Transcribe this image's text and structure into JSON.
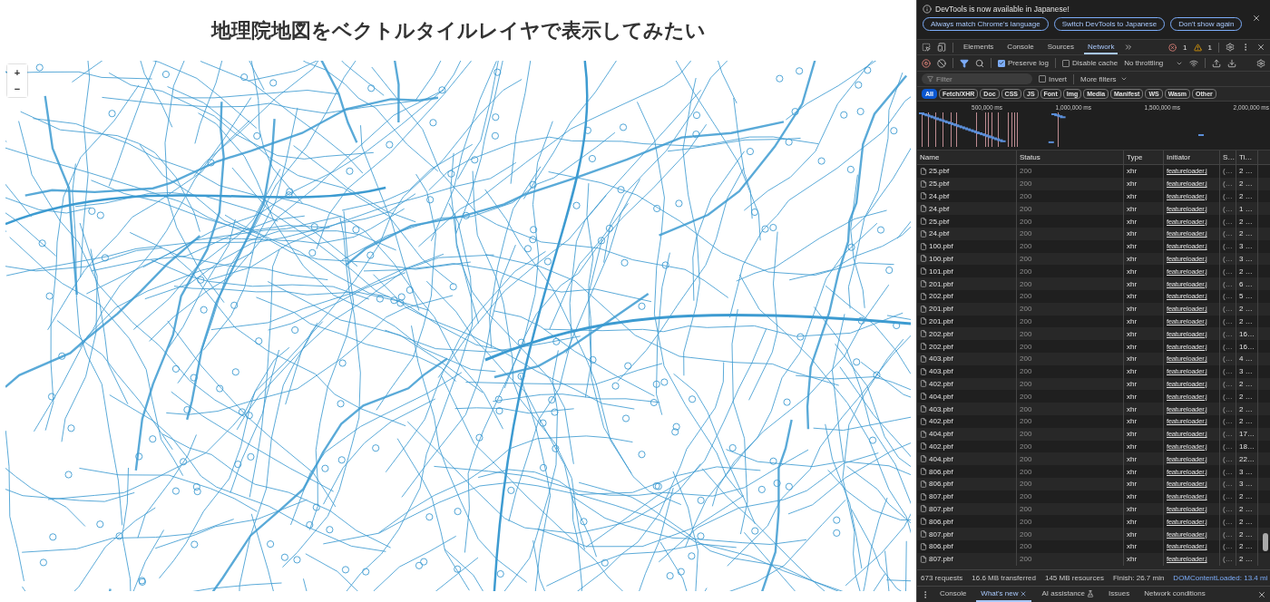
{
  "page": {
    "title": "地理院地図をベクトルタイルレイヤで表示してみたい",
    "zoom_controls": [
      "+",
      "−"
    ]
  },
  "devtools": {
    "infobar": {
      "message": "DevTools is now available in Japanese!",
      "buttons": [
        "Always match Chrome's language",
        "Switch DevTools to Japanese",
        "Don't show again"
      ]
    },
    "panel_tabs": [
      {
        "label": "Elements",
        "selected": false
      },
      {
        "label": "Console",
        "selected": false
      },
      {
        "label": "Sources",
        "selected": false
      },
      {
        "label": "Network",
        "selected": true
      }
    ],
    "error_count": "1",
    "warning_count": "1",
    "toolbar": {
      "preserve_log": {
        "label": "Preserve log",
        "checked": true
      },
      "disable_cache": {
        "label": "Disable cache",
        "checked": false
      },
      "throttling": "No throttling"
    },
    "filter": {
      "placeholder": "Filter",
      "invert": {
        "label": "Invert",
        "checked": false
      },
      "more_filters": "More filters"
    },
    "type_filters": [
      {
        "label": "All",
        "selected": true
      },
      {
        "label": "Fetch/XHR",
        "selected": false
      },
      {
        "label": "Doc",
        "selected": false
      },
      {
        "label": "CSS",
        "selected": false
      },
      {
        "label": "JS",
        "selected": false
      },
      {
        "label": "Font",
        "selected": false
      },
      {
        "label": "Img",
        "selected": false
      },
      {
        "label": "Media",
        "selected": false
      },
      {
        "label": "Manifest",
        "selected": false
      },
      {
        "label": "WS",
        "selected": false
      },
      {
        "label": "Wasm",
        "selected": false
      },
      {
        "label": "Other",
        "selected": false
      }
    ],
    "overview": {
      "ticks": [
        "500,000 ms",
        "1,000,000 ms",
        "1,500,000 ms",
        "2,000,000 ms"
      ]
    },
    "table": {
      "columns": [
        "Name",
        "Status",
        "Type",
        "Initiator",
        "S…",
        "Ti…"
      ],
      "rows": [
        {
          "name": "25.pbf",
          "status": "200",
          "type": "xhr",
          "initiator": "featureloader.j",
          "size": "(…",
          "time": "2 …"
        },
        {
          "name": "25.pbf",
          "status": "200",
          "type": "xhr",
          "initiator": "featureloader.j",
          "size": "(…",
          "time": "2 …"
        },
        {
          "name": "24.pbf",
          "status": "200",
          "type": "xhr",
          "initiator": "featureloader.j",
          "size": "(…",
          "time": "2 …"
        },
        {
          "name": "24.pbf",
          "status": "200",
          "type": "xhr",
          "initiator": "featureloader.j",
          "size": "(…",
          "time": "1 …"
        },
        {
          "name": "25.pbf",
          "status": "200",
          "type": "xhr",
          "initiator": "featureloader.j",
          "size": "(…",
          "time": "2 …"
        },
        {
          "name": "24.pbf",
          "status": "200",
          "type": "xhr",
          "initiator": "featureloader.j",
          "size": "(…",
          "time": "2 …"
        },
        {
          "name": "100.pbf",
          "status": "200",
          "type": "xhr",
          "initiator": "featureloader.j",
          "size": "(…",
          "time": "3 …"
        },
        {
          "name": "100.pbf",
          "status": "200",
          "type": "xhr",
          "initiator": "featureloader.j",
          "size": "(…",
          "time": "3 …"
        },
        {
          "name": "101.pbf",
          "status": "200",
          "type": "xhr",
          "initiator": "featureloader.j",
          "size": "(…",
          "time": "2 …"
        },
        {
          "name": "201.pbf",
          "status": "200",
          "type": "xhr",
          "initiator": "featureloader.j",
          "size": "(…",
          "time": "6 …"
        },
        {
          "name": "202.pbf",
          "status": "200",
          "type": "xhr",
          "initiator": "featureloader.j",
          "size": "(…",
          "time": "5 …"
        },
        {
          "name": "201.pbf",
          "status": "200",
          "type": "xhr",
          "initiator": "featureloader.j",
          "size": "(…",
          "time": "2 …"
        },
        {
          "name": "201.pbf",
          "status": "200",
          "type": "xhr",
          "initiator": "featureloader.j",
          "size": "(…",
          "time": "2 …"
        },
        {
          "name": "202.pbf",
          "status": "200",
          "type": "xhr",
          "initiator": "featureloader.j",
          "size": "(…",
          "time": "16…"
        },
        {
          "name": "202.pbf",
          "status": "200",
          "type": "xhr",
          "initiator": "featureloader.j",
          "size": "(…",
          "time": "16…"
        },
        {
          "name": "403.pbf",
          "status": "200",
          "type": "xhr",
          "initiator": "featureloader.j",
          "size": "(…",
          "time": "4 …"
        },
        {
          "name": "403.pbf",
          "status": "200",
          "type": "xhr",
          "initiator": "featureloader.j",
          "size": "(…",
          "time": "3 …"
        },
        {
          "name": "402.pbf",
          "status": "200",
          "type": "xhr",
          "initiator": "featureloader.j",
          "size": "(…",
          "time": "2 …"
        },
        {
          "name": "404.pbf",
          "status": "200",
          "type": "xhr",
          "initiator": "featureloader.j",
          "size": "(…",
          "time": "2 …"
        },
        {
          "name": "403.pbf",
          "status": "200",
          "type": "xhr",
          "initiator": "featureloader.j",
          "size": "(…",
          "time": "2 …"
        },
        {
          "name": "402.pbf",
          "status": "200",
          "type": "xhr",
          "initiator": "featureloader.j",
          "size": "(…",
          "time": "2 …"
        },
        {
          "name": "404.pbf",
          "status": "200",
          "type": "xhr",
          "initiator": "featureloader.j",
          "size": "(…",
          "time": "17…"
        },
        {
          "name": "402.pbf",
          "status": "200",
          "type": "xhr",
          "initiator": "featureloader.j",
          "size": "(…",
          "time": "18…"
        },
        {
          "name": "404.pbf",
          "status": "200",
          "type": "xhr",
          "initiator": "featureloader.j",
          "size": "(…",
          "time": "22…"
        },
        {
          "name": "806.pbf",
          "status": "200",
          "type": "xhr",
          "initiator": "featureloader.j",
          "size": "(…",
          "time": "3 …"
        },
        {
          "name": "806.pbf",
          "status": "200",
          "type": "xhr",
          "initiator": "featureloader.j",
          "size": "(…",
          "time": "3 …"
        },
        {
          "name": "807.pbf",
          "status": "200",
          "type": "xhr",
          "initiator": "featureloader.j",
          "size": "(…",
          "time": "2 …"
        },
        {
          "name": "807.pbf",
          "status": "200",
          "type": "xhr",
          "initiator": "featureloader.j",
          "size": "(…",
          "time": "2 …"
        },
        {
          "name": "806.pbf",
          "status": "200",
          "type": "xhr",
          "initiator": "featureloader.j",
          "size": "(…",
          "time": "2 …"
        },
        {
          "name": "807.pbf",
          "status": "200",
          "type": "xhr",
          "initiator": "featureloader.j",
          "size": "(…",
          "time": "2 …"
        },
        {
          "name": "806.pbf",
          "status": "200",
          "type": "xhr",
          "initiator": "featureloader.j",
          "size": "(…",
          "time": "2 …"
        },
        {
          "name": "807.pbf",
          "status": "200",
          "type": "xhr",
          "initiator": "featureloader.j",
          "size": "(…",
          "time": "2 …"
        }
      ]
    },
    "summary": [
      {
        "text": "673 requests",
        "kind": "stat"
      },
      {
        "text": "16.6 MB transferred",
        "kind": "stat"
      },
      {
        "text": "145 MB resources",
        "kind": "stat"
      },
      {
        "text": "Finish: 26.7 min",
        "kind": "stat"
      },
      {
        "text": "DOMContentLoaded: 13.4 mi",
        "kind": "event"
      }
    ],
    "drawer_tabs": [
      {
        "label": "Console",
        "selected": false,
        "closable": false,
        "experimental": false
      },
      {
        "label": "What's new",
        "selected": true,
        "closable": true,
        "experimental": false
      },
      {
        "label": "AI assistance",
        "selected": false,
        "closable": false,
        "experimental": true
      },
      {
        "label": "Issues",
        "selected": false,
        "closable": false,
        "experimental": false
      },
      {
        "label": "Network conditions",
        "selected": false,
        "closable": false,
        "experimental": false
      }
    ]
  }
}
